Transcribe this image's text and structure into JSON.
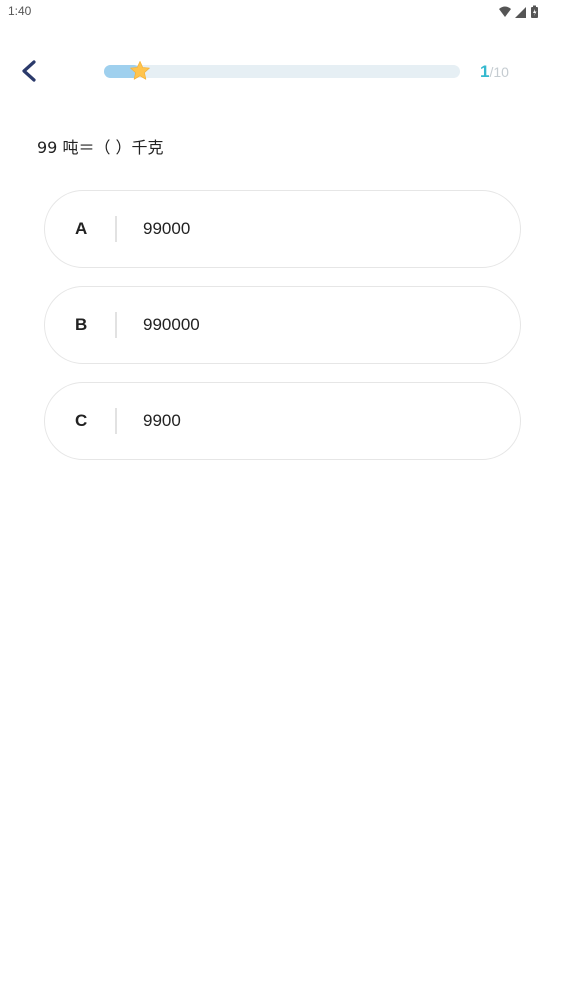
{
  "status_bar": {
    "time": "1:40",
    "icons": [
      "wifi-icon",
      "signal-icon",
      "battery-icon"
    ]
  },
  "header": {
    "back_icon": "chevron-left-icon",
    "progress": {
      "current": "1",
      "total": "/10",
      "fraction": 0.1,
      "marker_icon": "star-icon"
    }
  },
  "question": {
    "text": "99 吨＝（ ）千克"
  },
  "options": [
    {
      "letter": "A",
      "text": "99000"
    },
    {
      "letter": "B",
      "text": "990000"
    },
    {
      "letter": "C",
      "text": "9900"
    }
  ],
  "colors": {
    "accent": "#35b9cf",
    "progress_fill": "#9fd0ee",
    "progress_track": "#e6eff4",
    "star": "#ffc44d",
    "back_arrow": "#2b3a6b"
  }
}
